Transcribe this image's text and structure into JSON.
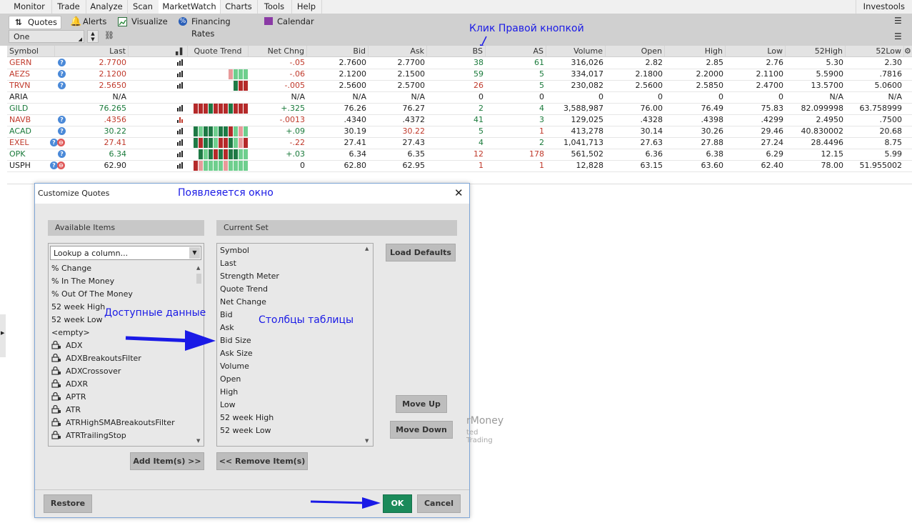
{
  "menubar": {
    "items": [
      "Monitor",
      "Trade",
      "Analyze",
      "Scan",
      "MarketWatch",
      "Charts",
      "Tools",
      "Help"
    ],
    "active": "MarketWatch",
    "right": "Investools"
  },
  "toolbar": {
    "tabs": [
      "Quotes",
      "Alerts",
      "Visualize",
      "Financing Rates",
      "Calendar"
    ],
    "active_tab": "Quotes",
    "watchlist": "One"
  },
  "annotations": {
    "right_click": "Клик Правой кнопкой",
    "window_appears": "Появлеяется окно",
    "available_data": "Доступные данные",
    "table_columns": "Столбцы таблицы"
  },
  "grid": {
    "columns": [
      "Symbol",
      "Last",
      "Quote Trend",
      "Net Chng",
      "Bid",
      "Ask",
      "BS",
      "AS",
      "Volume",
      "Open",
      "High",
      "Low",
      "52High",
      "52Low"
    ],
    "rows": [
      {
        "symbol": "GERN",
        "last": "2.7700",
        "net": "-.05",
        "bid": "2.7600",
        "ask": "2.7700",
        "bs": "38",
        "as": "61",
        "volume": "316,026",
        "open": "2.82",
        "high": "2.85",
        "low": "2.76",
        "h52": "5.30",
        "l52": "2.30"
      },
      {
        "symbol": "AEZS",
        "last": "2.1200",
        "net": "-.06",
        "bid": "2.1200",
        "ask": "2.1500",
        "bs": "59",
        "as": "5",
        "volume": "334,017",
        "open": "2.1800",
        "high": "2.2000",
        "low": "2.1100",
        "h52": "5.5900",
        "l52": ".7816"
      },
      {
        "symbol": "TRVN",
        "last": "2.5650",
        "net": "-.005",
        "bid": "2.5600",
        "ask": "2.5700",
        "bs": "26",
        "as": "5",
        "volume": "230,082",
        "open": "2.5600",
        "high": "2.5850",
        "low": "2.4700",
        "h52": "13.5700",
        "l52": "5.0600"
      },
      {
        "symbol": "ARIA",
        "last": "N/A",
        "net": "N/A",
        "bid": "N/A",
        "ask": "N/A",
        "bs": "0",
        "as": "0",
        "volume": "0",
        "open": "0",
        "high": "0",
        "low": "0",
        "h52": "N/A",
        "l52": "N/A"
      },
      {
        "symbol": "GILD",
        "last": "76.265",
        "net": "+.325",
        "bid": "76.26",
        "ask": "76.27",
        "bs": "2",
        "as": "4",
        "volume": "3,588,987",
        "open": "76.00",
        "high": "76.49",
        "low": "75.83",
        "h52": "82.099998",
        "l52": "63.758999"
      },
      {
        "symbol": "NAVB",
        "last": ".4356",
        "net": "-.0013",
        "bid": ".4340",
        "ask": ".4372",
        "bs": "41",
        "as": "3",
        "volume": "129,025",
        "open": ".4328",
        "high": ".4398",
        "low": ".4299",
        "h52": "2.4950",
        "l52": ".7500"
      },
      {
        "symbol": "ACAD",
        "last": "30.22",
        "net": "+.09",
        "bid": "30.19",
        "ask": "30.22",
        "bs": "5",
        "as": "1",
        "volume": "413,278",
        "open": "30.14",
        "high": "30.26",
        "low": "29.46",
        "h52": "40.830002",
        "l52": "20.68"
      },
      {
        "symbol": "EXEL",
        "last": "27.41",
        "net": "-.22",
        "bid": "27.41",
        "ask": "27.43",
        "bs": "4",
        "as": "2",
        "volume": "1,041,713",
        "open": "27.63",
        "high": "27.88",
        "low": "27.24",
        "h52": "28.4496",
        "l52": "8.75"
      },
      {
        "symbol": "OPK",
        "last": "6.34",
        "net": "+.03",
        "bid": "6.34",
        "ask": "6.35",
        "bs": "12",
        "as": "178",
        "volume": "561,502",
        "open": "6.36",
        "high": "6.38",
        "low": "6.29",
        "h52": "12.15",
        "l52": "5.99"
      },
      {
        "symbol": "USPH",
        "last": "62.90",
        "net": "0",
        "bid": "62.80",
        "ask": "62.95",
        "bs": "1",
        "as": "1",
        "volume": "12,828",
        "open": "63.15",
        "high": "63.60",
        "low": "62.40",
        "h52": "78.00",
        "l52": "51.955002"
      }
    ]
  },
  "dialog": {
    "title": "Customize Quotes",
    "available_header": "Available Items",
    "current_header": "Current Set",
    "lookup_placeholder": "Lookup a column...",
    "available_items": [
      "% Change",
      "% In The Money",
      "% Out Of The Money",
      "52 week High",
      "52 week Low",
      "<empty>",
      "ADX",
      "ADXBreakoutsFilter",
      "ADXCrossover",
      "ADXR",
      "APTR",
      "ATR",
      "ATRHighSMABreakoutsFilter",
      "ATRTrailingStop"
    ],
    "current_items": [
      "Symbol",
      "Last",
      "Strength Meter",
      "Quote Trend",
      "Net Change",
      "Bid",
      "Ask",
      "Bid Size",
      "Ask Size",
      "Volume",
      "Open",
      "High",
      "Low",
      "52 week High",
      "52 week Low"
    ],
    "buttons": {
      "load_defaults": "Load Defaults",
      "move_up": "Move Up",
      "move_down": "Move Down",
      "add": "Add Item(s) >>",
      "remove": "<< Remove Item(s)",
      "restore": "Restore",
      "ok": "OK",
      "cancel": "Cancel"
    },
    "background_text": [
      "rMoney",
      "ted Trading"
    ]
  },
  "colors": {
    "ok_green": "#1b8a5a",
    "annotation_blue": "#1a1ae6",
    "trend_dark_green": "#1e7a45",
    "trend_light_green": "#6fcf8e",
    "trend_dark_red": "#b52a2a",
    "trend_light_red": "#e89a9a"
  }
}
